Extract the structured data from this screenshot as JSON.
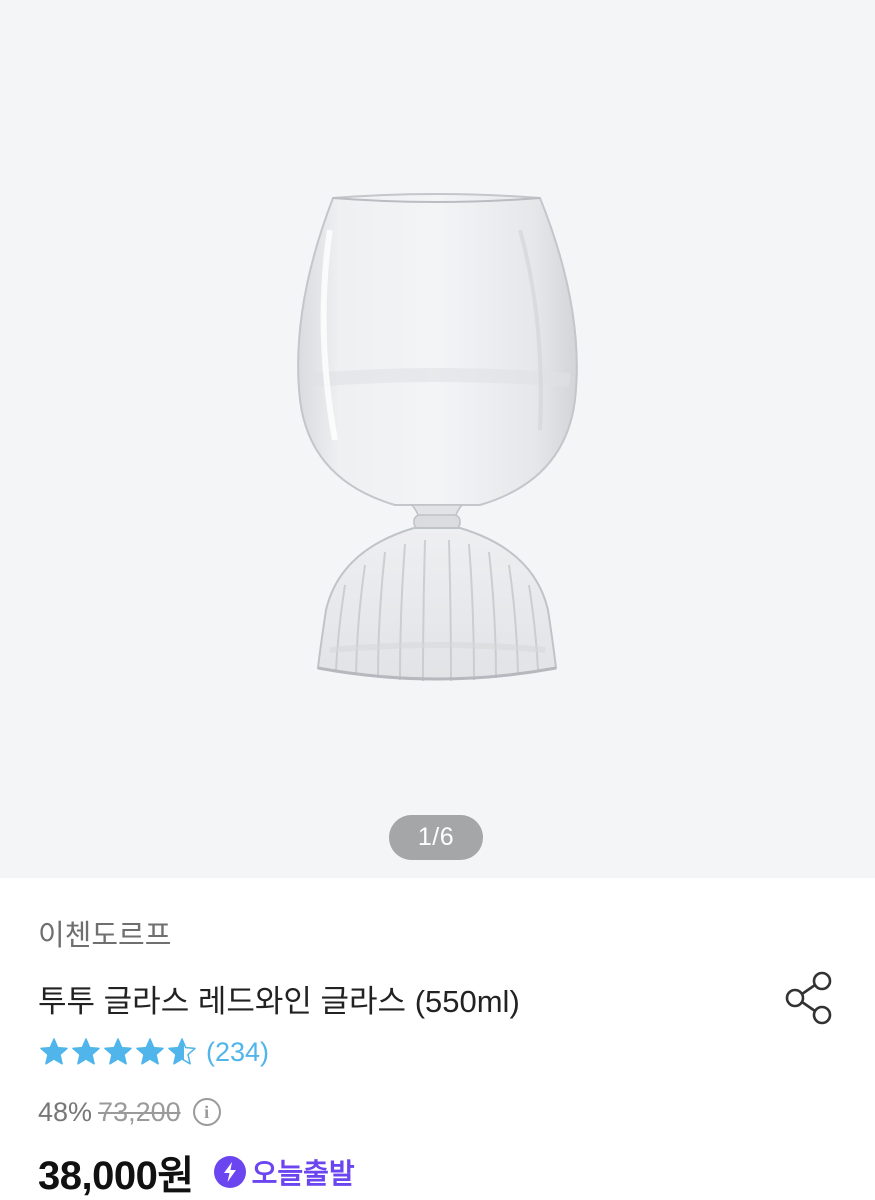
{
  "product_image": {
    "page_indicator": "1/6"
  },
  "product": {
    "brand": "이첸도르프",
    "title": "투투 글라스 레드와인 글라스 (550ml)",
    "rating": 4.5,
    "review_count": "(234)",
    "discount_rate": "48%",
    "original_price": "73,200",
    "price": "38,000원",
    "delivery_badge": "오늘출발"
  },
  "colors": {
    "star": "#4fb5ea",
    "review_count": "#4fb5ea",
    "delivery_accent": "#6b45f0",
    "hero_background": "#f4f5f7"
  },
  "icons": {
    "share": "share-icon",
    "info": "info-icon",
    "delivery": "lightning-bolt-icon",
    "star": "star-icon"
  }
}
